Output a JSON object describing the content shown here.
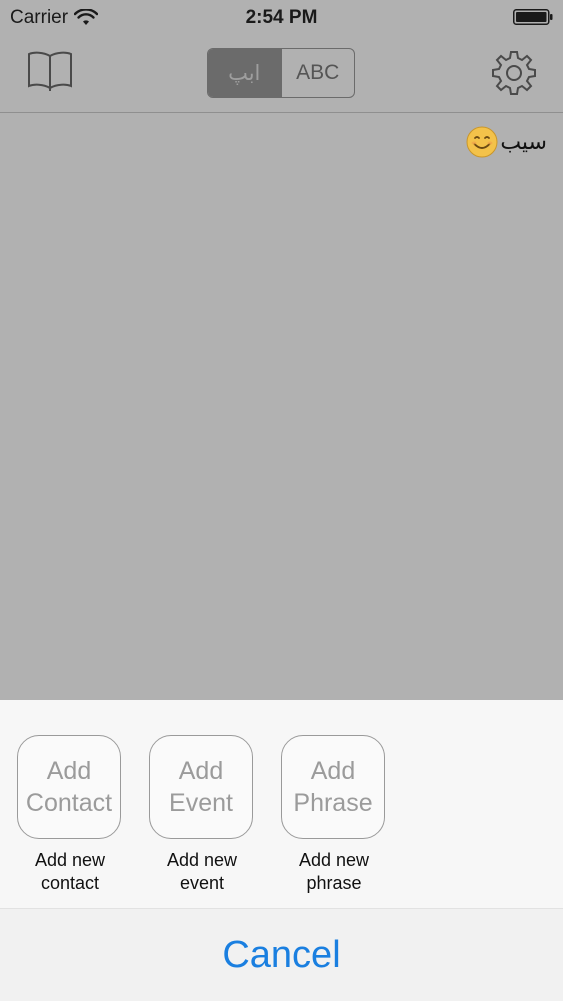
{
  "status_bar": {
    "carrier": "Carrier",
    "time": "2:54 PM"
  },
  "toolbar": {
    "book_icon": "book-icon",
    "gear_icon": "gear-icon",
    "segments": [
      {
        "label": "ابپ",
        "selected": true
      },
      {
        "label": "ABC",
        "selected": false
      }
    ]
  },
  "content": {
    "text": "سیب"
  },
  "sheet": {
    "actions": [
      {
        "tile_line1": "Add",
        "tile_line2": "Contact",
        "caption": "Add new\ncontact"
      },
      {
        "tile_line1": "Add",
        "tile_line2": "Event",
        "caption": "Add new\nevent"
      },
      {
        "tile_line1": "Add",
        "tile_line2": "Phrase",
        "caption": "Add new\nphrase"
      }
    ],
    "cancel_label": "Cancel"
  },
  "colors": {
    "accent": "#1a7fe0",
    "dim_background": "#b1b1b1",
    "sheet_background": "#f7f7f7"
  }
}
